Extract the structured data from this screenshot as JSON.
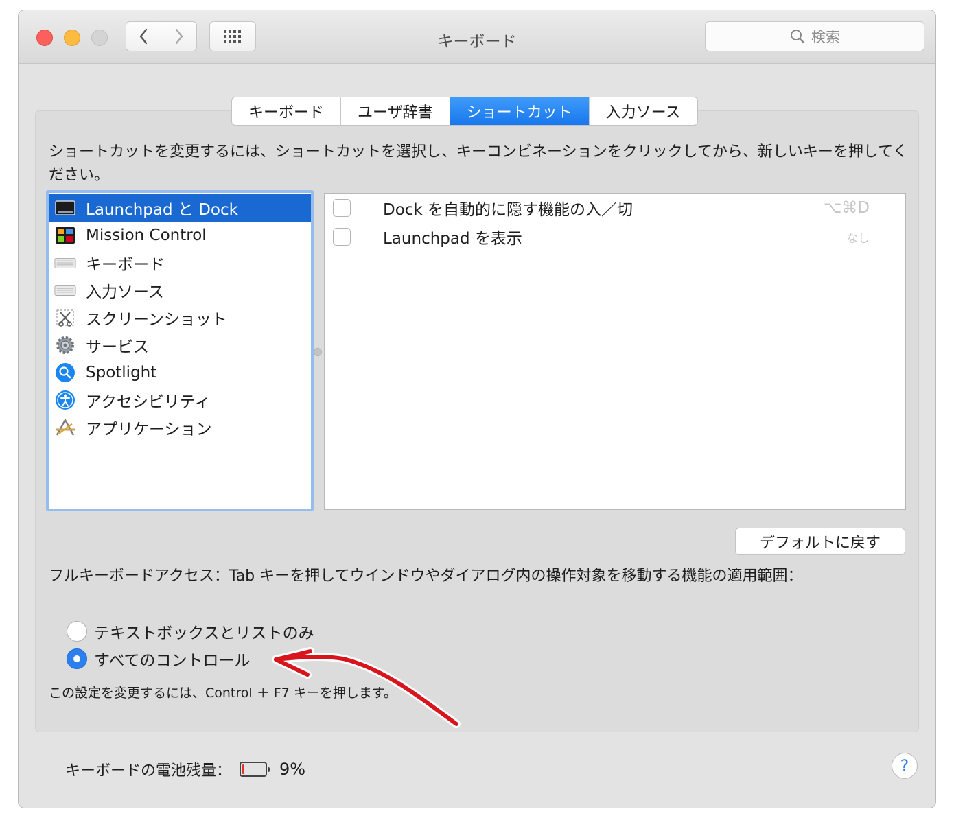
{
  "window": {
    "title": "キーボード"
  },
  "search": {
    "placeholder": "検索"
  },
  "tabs": [
    "キーボード",
    "ユーザ辞書",
    "ショートカット",
    "入力ソース"
  ],
  "instructions": "ショートカットを変更するには、ショートカットを選択し、キーコンビネーションをクリックしてから、新しいキーを押してください。",
  "categories": [
    "Launchpad と Dock",
    "Mission Control",
    "キーボード",
    "入力ソース",
    "スクリーンショット",
    "サービス",
    "Spotlight",
    "アクセシビリティ",
    "アプリケーション"
  ],
  "shortcuts": [
    {
      "label": "Dock を自動的に隠す機能の入／切",
      "key": "⌥⌘D"
    },
    {
      "label": "Launchpad を表示",
      "key": "なし"
    }
  ],
  "restore_defaults": "デフォルトに戻す",
  "full_keyboard_access": "フルキーボードアクセス：Tab キーを押してウインドウやダイアログ内の操作対象を移動する機能の適用範囲：",
  "radio_options": [
    "テキストボックスとリストのみ",
    "すべてのコントロール"
  ],
  "selected_radio": "すべてのコントロール",
  "note": "この設定を変更するには、Control ＋ F7 キーを押します。",
  "battery": {
    "label": "キーボードの電池残量：",
    "percent_text": "9%",
    "level": 0.09
  },
  "help": "?",
  "colors": {
    "accent": "#1a68d1",
    "arrow": "#d8141c"
  }
}
